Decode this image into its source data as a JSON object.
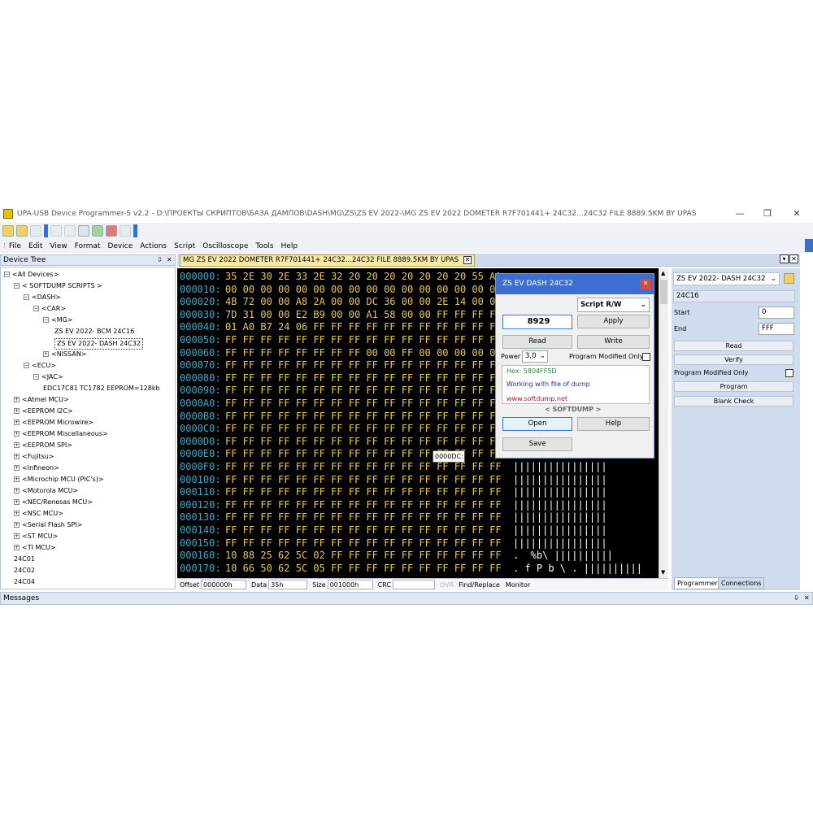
{
  "window": {
    "title": "UPA-USB Device Programmer-S v2.2 - D:\\ПРОЕКТЫ СКРИПТОВ\\БАЗА ДАМПОВ\\DASH\\MG\\ZS\\ZS EV 2022-\\MG ZS EV 2022 DOMETER R7F701441+ 24C32...24C32 FILE 8889.5KM BY UPAS",
    "minimize": "—",
    "maximize": "❐",
    "close": "✕"
  },
  "menu": [
    "File",
    "Edit",
    "View",
    "Format",
    "Device",
    "Actions",
    "Script",
    "Oscilloscope",
    "Tools",
    "Help"
  ],
  "device_tree": {
    "title": "Device Tree",
    "pin": "⇩",
    "close": "✕",
    "nodes": [
      {
        "label": "<All Devices>",
        "pm": "−"
      },
      {
        "label": "< SOFTDUMP SCRIPTS >",
        "pm": "−"
      },
      {
        "label": "<DASH>",
        "pm": "−"
      },
      {
        "label": "<CAR>",
        "pm": "−"
      },
      {
        "label": "<MG>",
        "pm": "−"
      },
      {
        "label": "ZS EV 2022- BCM 24C16",
        "pm": ""
      },
      {
        "label": "ZS EV 2022- DASH 24C32",
        "pm": ""
      },
      {
        "label": "<NISSAN>",
        "pm": "+"
      },
      {
        "label": "<ECU>",
        "pm": "−"
      },
      {
        "label": "<JAC>",
        "pm": "−"
      },
      {
        "label": "EDC17C81 TC1782 EEPROM=128kb",
        "pm": ""
      },
      {
        "label": "<Atmel MCU>",
        "pm": "+"
      },
      {
        "label": "<EEPROM I2C>",
        "pm": "+"
      },
      {
        "label": "<EEPROM Microwire>",
        "pm": "+"
      },
      {
        "label": "<EEPROM Miscellaneous>",
        "pm": "+"
      },
      {
        "label": "<EEPROM SPI>",
        "pm": "+"
      },
      {
        "label": "<Fujitsu>",
        "pm": "+"
      },
      {
        "label": "<Infineon>",
        "pm": "+"
      },
      {
        "label": "<Microchip MCU (PIC's)>",
        "pm": "+"
      },
      {
        "label": "<Motorola MCU>",
        "pm": "+"
      },
      {
        "label": "<NEC/Renesas MCU>",
        "pm": "+"
      },
      {
        "label": "<NSC MCU>",
        "pm": "+"
      },
      {
        "label": "<Serial Flash SPI>",
        "pm": "+"
      },
      {
        "label": "<ST MCU>",
        "pm": "+"
      },
      {
        "label": "<TI MCU>",
        "pm": "+"
      },
      {
        "label": "24C01",
        "pm": ""
      },
      {
        "label": "24C02",
        "pm": ""
      },
      {
        "label": "24C04",
        "pm": ""
      }
    ]
  },
  "doc_tab": {
    "label": "MG ZS EV 2022 DOMETER R7F701441+ 24C32...24C32 FILE 8889.5KM BY UPAS",
    "close": "✕"
  },
  "hex_rows": [
    {
      "addr": "000000:",
      "bytes": "35 2E 30 2E 33 2E 32 20 20 20 20 20 20 20 55 AA",
      "ascii": ""
    },
    {
      "addr": "000010:",
      "bytes": "00 00 00 00 00 00 00 00 00 00 00 00 00 00 00 00",
      "ascii": ""
    },
    {
      "addr": "000020:",
      "bytes": "4B 72 00 00 A8 2A 00 00 DC 36 00 00 2E 14 00 00",
      "ascii": ""
    },
    {
      "addr": "000030:",
      "bytes": "7D 31 00 00 E2 B9 00 00 A1 58 00 00 FF FF FF FF",
      "ascii": ""
    },
    {
      "addr": "000040:",
      "bytes": "01 A0 B7 24 06 FF FF FF FF FF FF FF FF FF FF FF",
      "ascii": ""
    },
    {
      "addr": "000050:",
      "bytes": "FF FF FF FF FF FF FF FF FF FF FF FF FF FF FF FF",
      "ascii": ""
    },
    {
      "addr": "000060:",
      "bytes": "FF FF FF FF FF FF FF FF 00 00 FF 00 00 00 00 01",
      "ascii": ""
    },
    {
      "addr": "000070:",
      "bytes": "FF FF FF FF FF FF FF FF FF FF FF FF FF FF FF FF",
      "ascii": ""
    },
    {
      "addr": "000080:",
      "bytes": "FF FF FF FF FF FF FF FF FF FF FF FF FF FF FF FF",
      "ascii": ""
    },
    {
      "addr": "000090:",
      "bytes": "FF FF FF FF FF FF FF FF FF FF FF FF FF FF FF FF",
      "ascii": ""
    },
    {
      "addr": "0000A0:",
      "bytes": "FF FF FF FF FF FF FF FF FF FF FF FF FF FF FF FF",
      "ascii": ""
    },
    {
      "addr": "0000B0:",
      "bytes": "FF FF FF FF FF FF FF FF FF FF FF FF FF FF FF FF",
      "ascii": ""
    },
    {
      "addr": "0000C0:",
      "bytes": "FF FF FF FF FF FF FF FF FF FF FF FF FF FF FF FF",
      "ascii": ""
    },
    {
      "addr": "0000D0:",
      "bytes": "FF FF FF FF FF FF FF FF FF FF FF FF FF FF FF FF",
      "ascii": ""
    },
    {
      "addr": "0000E0:",
      "bytes": "FF FF FF FF FF FF FF FF FF FF FF FF FF FF FF FF",
      "ascii": ""
    },
    {
      "addr": "0000F0:",
      "bytes": "FF FF FF FF FF FF FF FF FF FF FF FF FF FF FF FF",
      "ascii": "  ||||||||||||||||"
    },
    {
      "addr": "000100:",
      "bytes": "FF FF FF FF FF FF FF FF FF FF FF FF FF FF FF FF",
      "ascii": "  ||||||||||||||||"
    },
    {
      "addr": "000110:",
      "bytes": "FF FF FF FF FF FF FF FF FF FF FF FF FF FF FF FF",
      "ascii": "  ||||||||||||||||"
    },
    {
      "addr": "000120:",
      "bytes": "FF FF FF FF FF FF FF FF FF FF FF FF FF FF FF FF",
      "ascii": "  ||||||||||||||||"
    },
    {
      "addr": "000130:",
      "bytes": "FF FF FF FF FF FF FF FF FF FF FF FF FF FF FF FF",
      "ascii": "  ||||||||||||||||"
    },
    {
      "addr": "000140:",
      "bytes": "FF FF FF FF FF FF FF FF FF FF FF FF FF FF FF FF",
      "ascii": "  ||||||||||||||||"
    },
    {
      "addr": "000150:",
      "bytes": "FF FF FF FF FF FF FF FF FF FF FF FF FF FF FF FF",
      "ascii": "  ||||||||||||||||"
    },
    {
      "addr": "000160:",
      "bytes": "10 88 25 62 5C 02 FF FF FF FF FF FF FF FF FF FF",
      "ascii": "  .  %b\\ ||||||||||"
    },
    {
      "addr": "000170:",
      "bytes": "10 66 50 62 5C 05 FF FF FF FF FF FF FF FF FF FF",
      "ascii": "  . f P b \\ . ||||||||||"
    }
  ],
  "hex_tooltip": "0000DC:",
  "statusbar": {
    "offset_label": "Offset",
    "offset_value": "000000h",
    "data_label": "Data",
    "data_value": "35h",
    "size_label": "Size",
    "size_value": "001000h",
    "crc_label": "CRC",
    "crc_value": "",
    "ovr": "OVR",
    "find_replace": "Find/Replace",
    "monitor": "Monitor"
  },
  "dialog": {
    "title": "ZS EV DASH 24C32",
    "close": "✕",
    "value_field": "8929",
    "script_select": "Script R/W",
    "apply": "Apply",
    "read": "Read",
    "write": "Write",
    "power_label": "Power",
    "power_value": "3,0",
    "program_modified_only": "Program Modified Only",
    "hex_line": "Hex: 5804FF5D",
    "info_line": "Working with file of dump",
    "url": "www.softdump.net",
    "brand": "< SOFTDUMP >",
    "open": "Open",
    "help": "Help",
    "save": "Save",
    "colors": {
      "hex": "#2a8a2a",
      "info": "#2a2ab0",
      "url": "#b02020"
    }
  },
  "right_panel": {
    "device_select": "ZS EV 2022- DASH 24C32",
    "chip": "24C16",
    "start_label": "Start",
    "start_value": "0",
    "end_label": "End",
    "end_value": "FFF",
    "read": "Read",
    "verify": "Verify",
    "program_modified_only": "Program Modified Only",
    "program": "Program",
    "blank_check": "Blank Check",
    "tabs": [
      "Programmer",
      "Connections"
    ]
  },
  "messages": {
    "title": "Messages",
    "pin": "⇩",
    "close": "✕"
  },
  "icons": [
    "new-icon",
    "open-icon",
    "save-icon",
    "program-icon",
    "chip-icon",
    "bug-icon",
    "erase-icon"
  ]
}
